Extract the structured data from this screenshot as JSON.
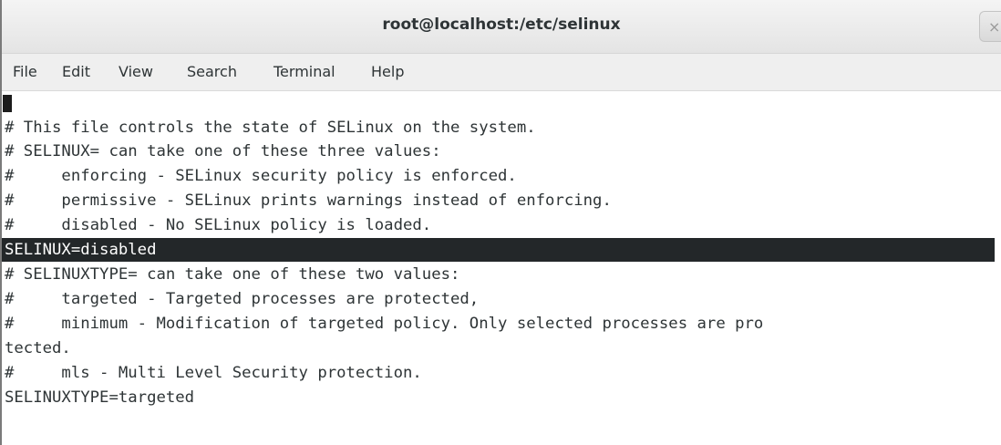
{
  "window": {
    "title": "root@localhost:/etc/selinux",
    "close_icon_glyph": "×"
  },
  "menubar": {
    "items": [
      "File",
      "Edit",
      "View",
      "Search",
      "Terminal",
      "Help"
    ]
  },
  "terminal": {
    "lines": [
      "",
      "# This file controls the state of SELinux on the system.",
      "# SELINUX= can take one of these three values:",
      "#     enforcing - SELinux security policy is enforced.",
      "#     permissive - SELinux prints warnings instead of enforcing.",
      "#     disabled - No SELinux policy is loaded.",
      "SELINUX=disabled",
      "# SELINUXTYPE= can take one of these two values:",
      "#     targeted - Targeted processes are protected,",
      "#     minimum - Modification of targeted policy. Only selected processes are pro",
      "tected.",
      "#     mls - Multi Level Security protection.",
      "SELINUXTYPE=targeted"
    ],
    "selected_line_index": 6
  },
  "colors": {
    "text": "#2e3436",
    "selection_background": "#232729",
    "selection_text": "#ffffff",
    "terminal_background": "#ffffff",
    "menubar_background": "#efefef"
  }
}
